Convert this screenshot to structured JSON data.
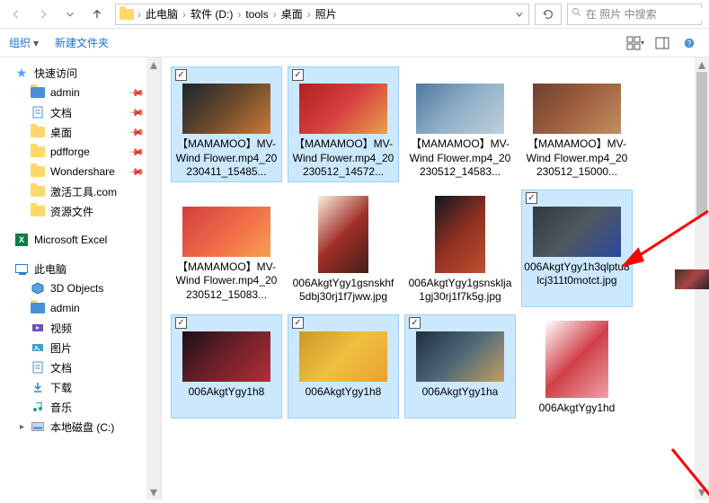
{
  "nav": {
    "back": "←",
    "forward": "→",
    "up": "↑"
  },
  "breadcrumbs": [
    "此电脑",
    "软件 (D:)",
    "tools",
    "桌面",
    "照片"
  ],
  "search": {
    "placeholder": "在 照片 中搜索"
  },
  "toolbar": {
    "organize": "组织",
    "newfolder": "新建文件夹"
  },
  "sidebar": {
    "quick_access": "快速访问",
    "quick_items": [
      {
        "label": "admin",
        "icon": "folder-blue",
        "pinned": true
      },
      {
        "label": "文档",
        "icon": "doc",
        "pinned": true
      },
      {
        "label": "桌面",
        "icon": "folder",
        "pinned": true
      },
      {
        "label": "pdfforge",
        "icon": "folder",
        "pinned": true
      },
      {
        "label": "Wondershare",
        "icon": "folder",
        "pinned": true
      },
      {
        "label": "激活工具.com",
        "icon": "folder",
        "pinned": false
      },
      {
        "label": "资源文件",
        "icon": "folder",
        "pinned": false
      }
    ],
    "excel": "Microsoft Excel",
    "this_pc": "此电脑",
    "pc_items": [
      {
        "label": "3D Objects",
        "icon": "3d"
      },
      {
        "label": "admin",
        "icon": "folder-blue"
      },
      {
        "label": "视频",
        "icon": "video"
      },
      {
        "label": "图片",
        "icon": "pictures"
      },
      {
        "label": "文档",
        "icon": "doc"
      },
      {
        "label": "下载",
        "icon": "download"
      },
      {
        "label": "音乐",
        "icon": "music"
      },
      {
        "label": "本地磁盘 (C:)",
        "icon": "disk"
      }
    ]
  },
  "files": [
    {
      "label": "【MAMAMOO】MV- Wind Flower.mp4_20230411_15485...",
      "selected": true,
      "shape": "wide",
      "colors": [
        "#1a2430",
        "#6b4a2a",
        "#c97a3a"
      ]
    },
    {
      "label": "【MAMAMOO】MV- Wind Flower.mp4_20230512_14572...",
      "selected": true,
      "shape": "wide",
      "colors": [
        "#b02020",
        "#d84040",
        "#e8a050"
      ]
    },
    {
      "label": "【MAMAMOO】MV- Wind Flower.mp4_20230512_14583...",
      "selected": false,
      "shape": "wide",
      "colors": [
        "#5078a0",
        "#90b0c8",
        "#c0d0d8"
      ]
    },
    {
      "label": "【MAMAMOO】MV- Wind Flower.mp4_20230512_15000...",
      "selected": false,
      "shape": "wide",
      "colors": [
        "#6b4030",
        "#a06040",
        "#c09060"
      ]
    },
    {
      "label": "【MAMAMOO】MV- Wind Flower.mp4_20230512_15083...",
      "selected": false,
      "shape": "wide",
      "colors": [
        "#d04040",
        "#f06848",
        "#f8a050"
      ]
    },
    {
      "label": "006AkgtYgy1gsnskhf5dbj30rj1f7jww.jpg",
      "selected": false,
      "shape": "tall",
      "colors": [
        "#faf0e0",
        "#a03028",
        "#402018"
      ]
    },
    {
      "label": "006AkgtYgy1gsnsklja1gj30rj1f7k5g.jpg",
      "selected": false,
      "shape": "tall",
      "colors": [
        "#101820",
        "#903020",
        "#c05030"
      ]
    },
    {
      "label": "006AkgtYgy1h3qlptu8lcj311t0motct.jpg",
      "selected": true,
      "shape": "wide",
      "colors": [
        "#303840",
        "#505860",
        "#2848a0"
      ]
    },
    {
      "label": "006AkgtYgy1h8",
      "selected": true,
      "shape": "wide",
      "colors": [
        "#181018",
        "#702028",
        "#b03038"
      ]
    },
    {
      "label": "006AkgtYgy1h8",
      "selected": true,
      "shape": "wide",
      "colors": [
        "#c89828",
        "#f0c040",
        "#e8a030"
      ]
    },
    {
      "label": "006AkgtYgy1ha",
      "selected": true,
      "shape": "wide",
      "colors": [
        "#203040",
        "#506878",
        "#c0a060"
      ]
    },
    {
      "label": "006AkgtYgy1hd",
      "selected": false,
      "shape": "port",
      "colors": [
        "#ffffff",
        "#d04048",
        "#f0a0a8"
      ]
    }
  ]
}
